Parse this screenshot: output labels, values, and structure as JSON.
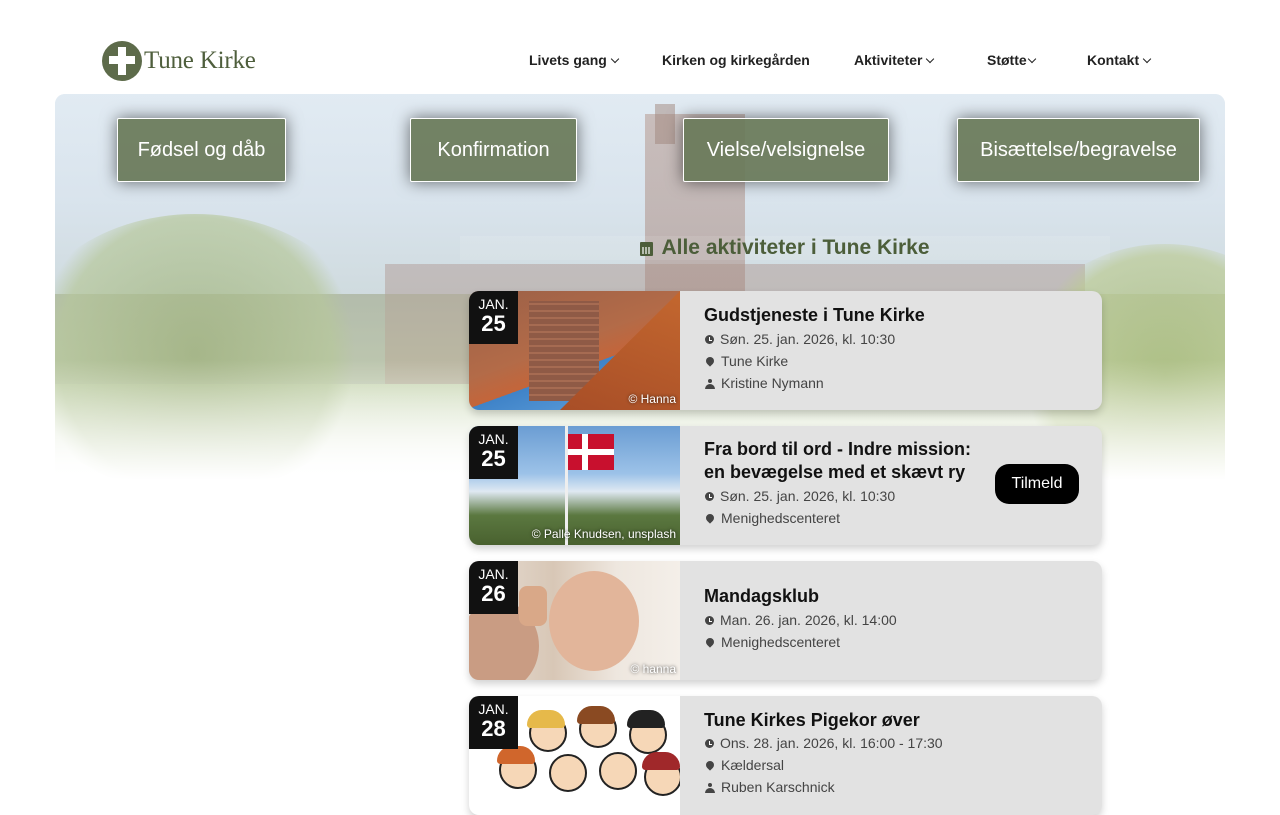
{
  "brand": {
    "name": "Tune Kirke"
  },
  "nav": [
    {
      "label": "Livets gang",
      "has_dropdown": true
    },
    {
      "label": "Kirken og kirkegården",
      "has_dropdown": false
    },
    {
      "label": "Aktiviteter",
      "has_dropdown": true
    },
    {
      "label": "Støtte",
      "has_dropdown": true
    },
    {
      "label": "Kontakt",
      "has_dropdown": true
    }
  ],
  "life_events": [
    "Fødsel og dåb",
    "Konfirmation",
    "Vielse/velsignelse",
    "Bisættelse/begravelse"
  ],
  "activities": {
    "heading": "Alle aktiviteter i Tune Kirke",
    "events": [
      {
        "month": "JAN.",
        "day": "25",
        "title": "Gudstjeneste i Tune Kirke",
        "time": "Søn. 25. jan. 2026, kl. 10:30",
        "location": "Tune Kirke",
        "person": "Kristine Nymann",
        "credit": "© Hanna"
      },
      {
        "month": "JAN.",
        "day": "25",
        "title": "Fra bord til ord - Indre mission: en bevægelse med et skævt ry",
        "time": "Søn. 25. jan. 2026, kl. 10:30",
        "location": "Menighedscenteret",
        "credit": "© Palle Knudsen, unsplash",
        "signup_label": "Tilmeld"
      },
      {
        "month": "JAN.",
        "day": "26",
        "title": "Mandagsklub",
        "time": "Man. 26. jan. 2026, kl. 14:00",
        "location": "Menighedscenteret",
        "credit": "© hanna"
      },
      {
        "month": "JAN.",
        "day": "28",
        "title": "Tune Kirkes Pigekor øver",
        "time": "Ons. 28. jan. 2026, kl. 16:00 - 17:30",
        "location": "Kældersal",
        "person": "Ruben Karschnick"
      }
    ]
  },
  "colors": {
    "accent": "#687858",
    "heading_green": "#4c5e3a",
    "card_bg": "#e2e2e2",
    "date_bg": "#111111"
  },
  "icons": {
    "calendar": "calendar-icon",
    "clock": "clock-icon",
    "location": "location-pin-icon",
    "person": "person-icon",
    "chevron": "chevron-down-icon"
  }
}
